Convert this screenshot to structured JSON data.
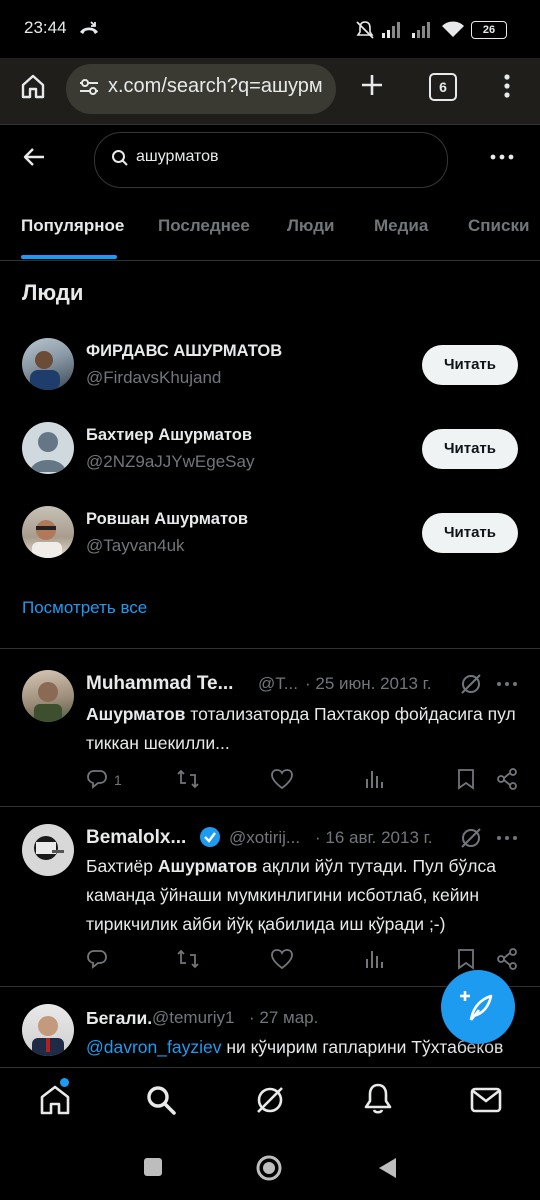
{
  "status_bar": {
    "time": "23:44",
    "battery": "26"
  },
  "browser": {
    "url": "x.com/search?q=ашурм",
    "tab_count": "6"
  },
  "search": {
    "query": "ашурматов"
  },
  "tabs": [
    "Популярное",
    "Последнее",
    "Люди",
    "Медиа",
    "Списки"
  ],
  "people_section": {
    "title": "Люди",
    "people": [
      {
        "name": "ФИРДАВС АШУРМАТОВ",
        "handle": "@FirdavsKhujand",
        "follow": "Читать"
      },
      {
        "name": "Бахтиер Ашурматов",
        "handle": "@2NZ9aJJYwEgeSay",
        "follow": "Читать"
      },
      {
        "name": "Ровшан Ашурматов",
        "handle": "@Tayvan4uk",
        "follow": "Читать"
      }
    ],
    "see_all": "Посмотреть все"
  },
  "tweets": [
    {
      "name": "Muhammad Te...",
      "handle": "@T...",
      "date": "· 25 июн. 2013 г.",
      "text_bold": "Ашурматов",
      "text_rest": " тотализаторда Пахтакор фойдасига пул тиккан шекилли...",
      "replies": "1"
    },
    {
      "name": "Bemalolx...",
      "handle": "@xotirij...",
      "date": "· 16 авг. 2013 г.",
      "text_pre": "Бахтиёр ",
      "text_bold": "Ашурматов",
      "text_rest": " ақлли йўл тутади. Пул бўлса каманда ўйнаши мумкинлигини исботлаб, кейин тирикчилик айби йўқ қабилида иш кўради ;-)",
      "replies": ""
    },
    {
      "name": "Бегали.",
      "handle": "@temuriy1",
      "date": "· 27 мар.",
      "mention": "@davron_fayziev",
      "text_rest": " ни кўчирим гапларини Тўхтабеков"
    }
  ],
  "colors": {
    "accent": "#1d9bf0",
    "background": "#000000",
    "muted": "#71767b"
  }
}
